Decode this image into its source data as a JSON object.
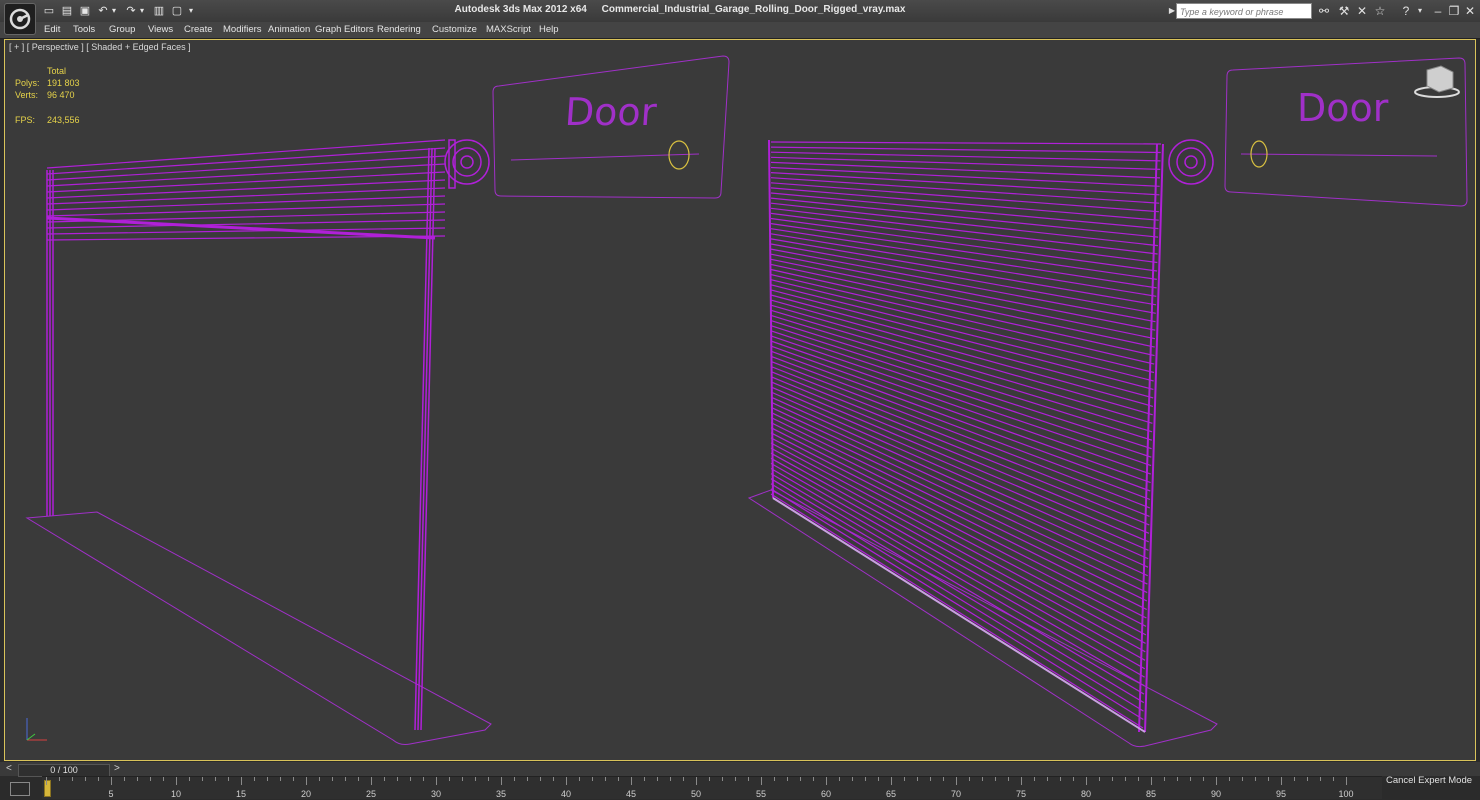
{
  "window": {
    "app_title": "Autodesk 3ds Max  2012 x64",
    "file_title": "Commercial_Industrial_Garage_Rolling_Door_Rigged_vray.max"
  },
  "search": {
    "placeholder": "Type a keyword or phrase"
  },
  "menu": {
    "items": [
      {
        "label": "Edit"
      },
      {
        "label": "Tools"
      },
      {
        "label": "Group"
      },
      {
        "label": "Views"
      },
      {
        "label": "Create"
      },
      {
        "label": "Modifiers"
      },
      {
        "label": "Animation"
      },
      {
        "label": "Graph Editors"
      },
      {
        "label": "Rendering"
      },
      {
        "label": "Customize"
      },
      {
        "label": "MAXScript"
      },
      {
        "label": "Help"
      }
    ]
  },
  "viewport": {
    "label": "[ + ] [ Perspective ] [ Shaded + Edged Faces ]",
    "stats": {
      "header": "Total",
      "polys_label": "Polys:",
      "polys_value": "191 803",
      "verts_label": "Verts:",
      "verts_value": "96 470",
      "fps_label": "FPS:",
      "fps_value": "243,556"
    },
    "control_label_left": "Door",
    "control_label_right": "Door",
    "wire_color": "#b020d8",
    "outline_color": "#a030c8",
    "slider_knob_color": "#d8c040"
  },
  "timeline": {
    "slider_text": "0 / 100",
    "prev": "<",
    "next": ">",
    "ticks": [
      "5",
      "10",
      "15",
      "20",
      "25",
      "30",
      "35",
      "40",
      "45",
      "50",
      "55",
      "60",
      "65",
      "70",
      "75",
      "80",
      "85",
      "90",
      "95",
      "100"
    ],
    "frame_min": 0,
    "frame_max": 100,
    "current_frame": 0
  },
  "status": {
    "cancel_expert": "Cancel Expert Mode"
  }
}
